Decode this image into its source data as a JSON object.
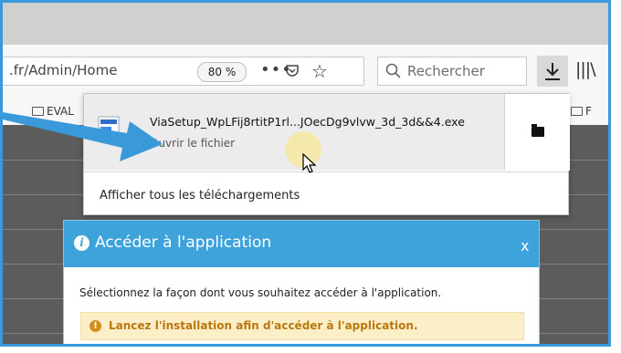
{
  "browser": {
    "url": ".fr/Admin/Home",
    "zoom": "80 %",
    "search_placeholder": "Rechercher",
    "bookmarks": [
      {
        "label": "EVAL"
      },
      {
        "label": "F"
      }
    ]
  },
  "downloads_panel": {
    "filename": "ViaSetup_WpLFij8rtitP1rl...JOecDg9vlvw_3d_3d&&4.exe",
    "status": "Ouvrir le fichier",
    "show_all_label": "Afficher tous les téléchargements"
  },
  "dialog": {
    "title": "Accéder à l'application",
    "close_label": "x",
    "message": "Sélectionnez la façon dont vous souhaitez accéder à l'application.",
    "warning": "Lancez l'installation afin d'accéder à l'application."
  },
  "colors": {
    "accent_blue": "#3ea3db",
    "annotation_arrow": "#3a9ad9",
    "warning_bg": "#fcefc8",
    "warning_text": "#b9770e"
  }
}
